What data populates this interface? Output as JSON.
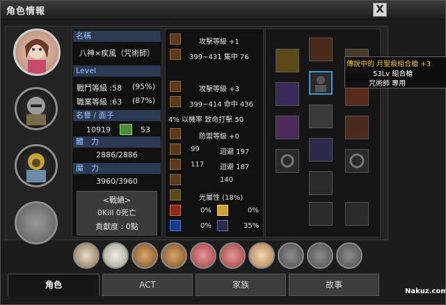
{
  "window": {
    "title": "角色情報",
    "close_label": "X"
  },
  "character": {
    "name_header": "名稱",
    "name": "八神×疾風（咒術師）",
    "level_header": "Level",
    "combat_level_label": "戰鬥等級 :58",
    "combat_level_pct": "(95%)",
    "job_level_label": "職業等級 :63",
    "job_level_pct": "(87%)",
    "fame_header": "名譽 / 面子",
    "fame": "10919",
    "face": "53",
    "hp_header": "體　力",
    "hp": "2886/2886",
    "mp_header": "魔　力",
    "mp": "3960/3960",
    "record_header": "<戰績>",
    "kills": "0Kill 0死亡",
    "contribution": "貢獻度 : 0點"
  },
  "stats": {
    "attack1_title": "攻擊等級 +1",
    "attack1_line": "399~431 集中 76",
    "attack2_title": "攻擊等級 +3",
    "attack2_line": "399~414 命中 436",
    "crit_line": "4% 以機率 致命打擊  50",
    "defense_title": "防禦等級 +0",
    "def1_a": "99",
    "def1_b": "迴避 197",
    "def2_a": "117",
    "def2_b": "迴避 187",
    "def3": "140",
    "element_title": "光屬性 (18%)",
    "fire": "0%",
    "light": "0%",
    "water": "0%",
    "dark": "35%"
  },
  "tooltip": {
    "item_name": "傳說中的 月聖痕組合槍 +3",
    "item_level": "53Lv 組合槍",
    "item_class": "咒術師 專用"
  },
  "tabs": {
    "character": "角色",
    "act": "ACT",
    "family": "家族",
    "story": "故事"
  },
  "logo": "Nakuz.com",
  "colors": {
    "header_bg": "#2a3a52",
    "header_text": "#9cc4ff",
    "selected_slot": "#3a9ad8"
  }
}
